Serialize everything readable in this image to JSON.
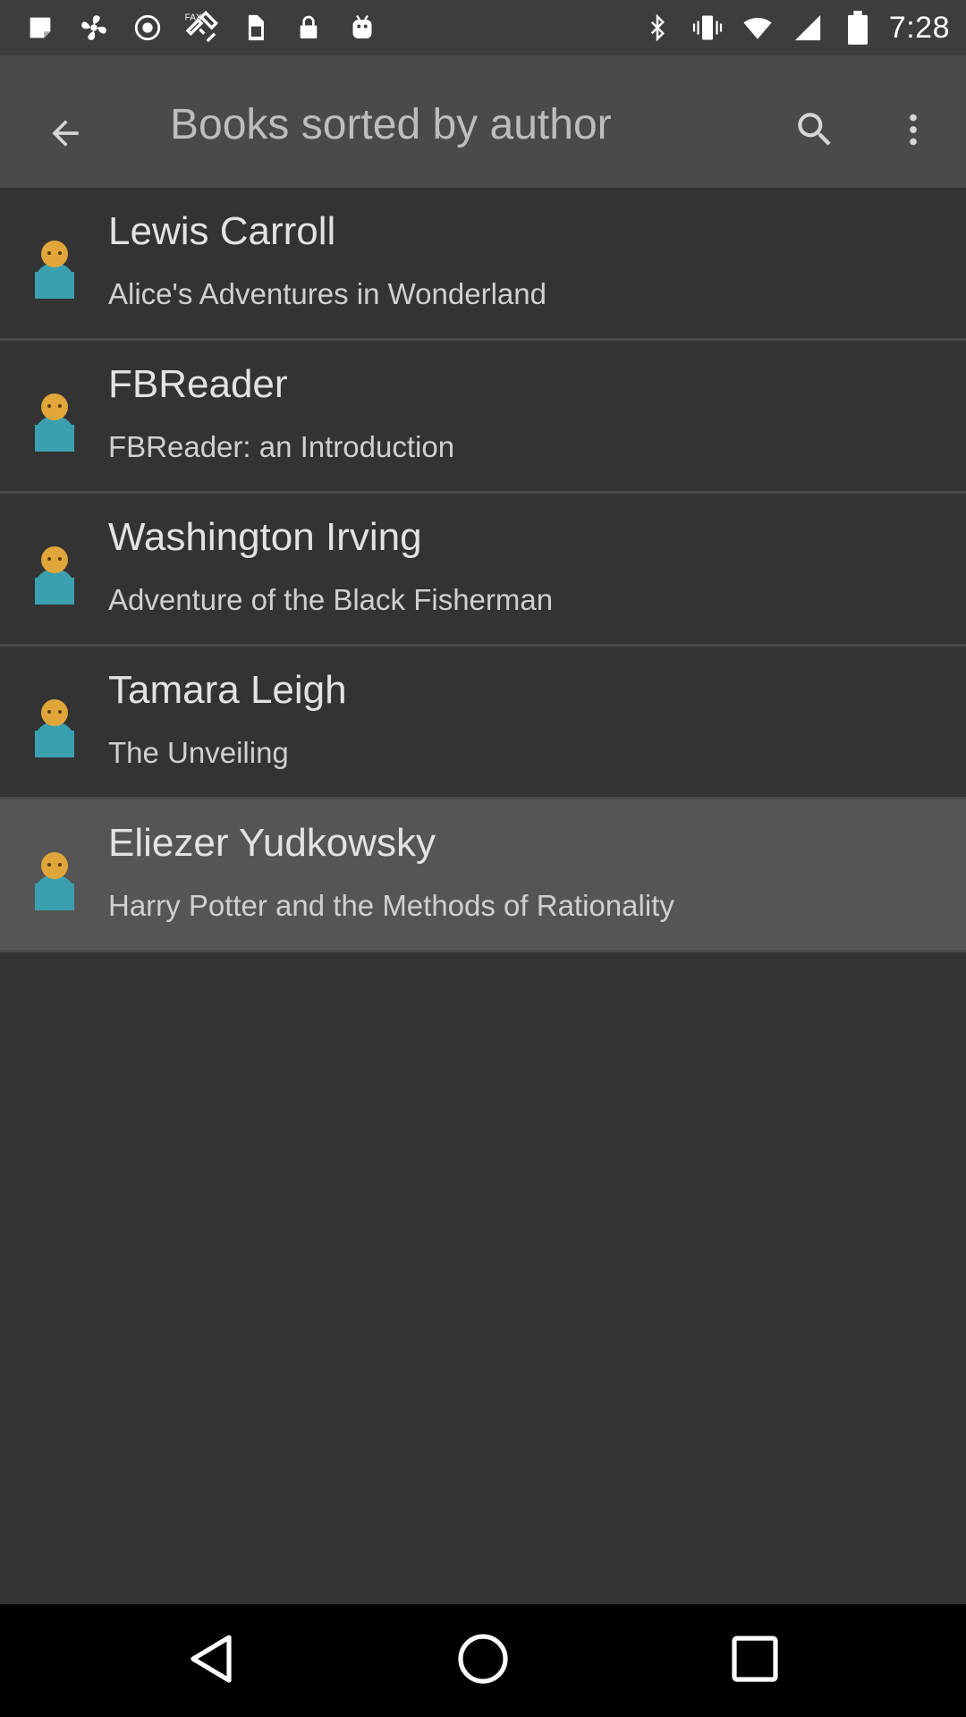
{
  "status_bar": {
    "time": "7:28",
    "left_icons": [
      "sticky-note-icon",
      "fan-icon",
      "radio-icon",
      "fax-icon",
      "sim-icon",
      "lock-icon",
      "android-icon"
    ],
    "right_icons": [
      "bluetooth-icon",
      "vibrate-icon",
      "wifi-icon",
      "signal-icon",
      "battery-icon"
    ]
  },
  "app_bar": {
    "title": "Books sorted by author",
    "back_icon": "arrow-back-icon",
    "search_icon": "search-icon",
    "more_icon": "more-vert-icon"
  },
  "authors": [
    {
      "author": "Lewis Carroll",
      "book": "Alice's Adventures in Wonderland",
      "selected": false
    },
    {
      "author": "FBReader",
      "book": "FBReader: an Introduction",
      "selected": false
    },
    {
      "author": "Washington Irving",
      "book": "Adventure of the Black Fisherman",
      "selected": false
    },
    {
      "author": "Tamara Leigh",
      "book": "The Unveiling",
      "selected": false
    },
    {
      "author": "Eliezer Yudkowsky",
      "book": "Harry Potter and the Methods of Rationality",
      "selected": true
    }
  ],
  "nav_bar": {
    "buttons": [
      "back-triangle-icon",
      "home-circle-icon",
      "recents-square-icon"
    ]
  },
  "colors": {
    "status_bar": "#3d3d3d",
    "app_bar": "#4a4a4a",
    "background": "#333333",
    "selected_row": "#555555",
    "nav_bar": "#000000"
  }
}
